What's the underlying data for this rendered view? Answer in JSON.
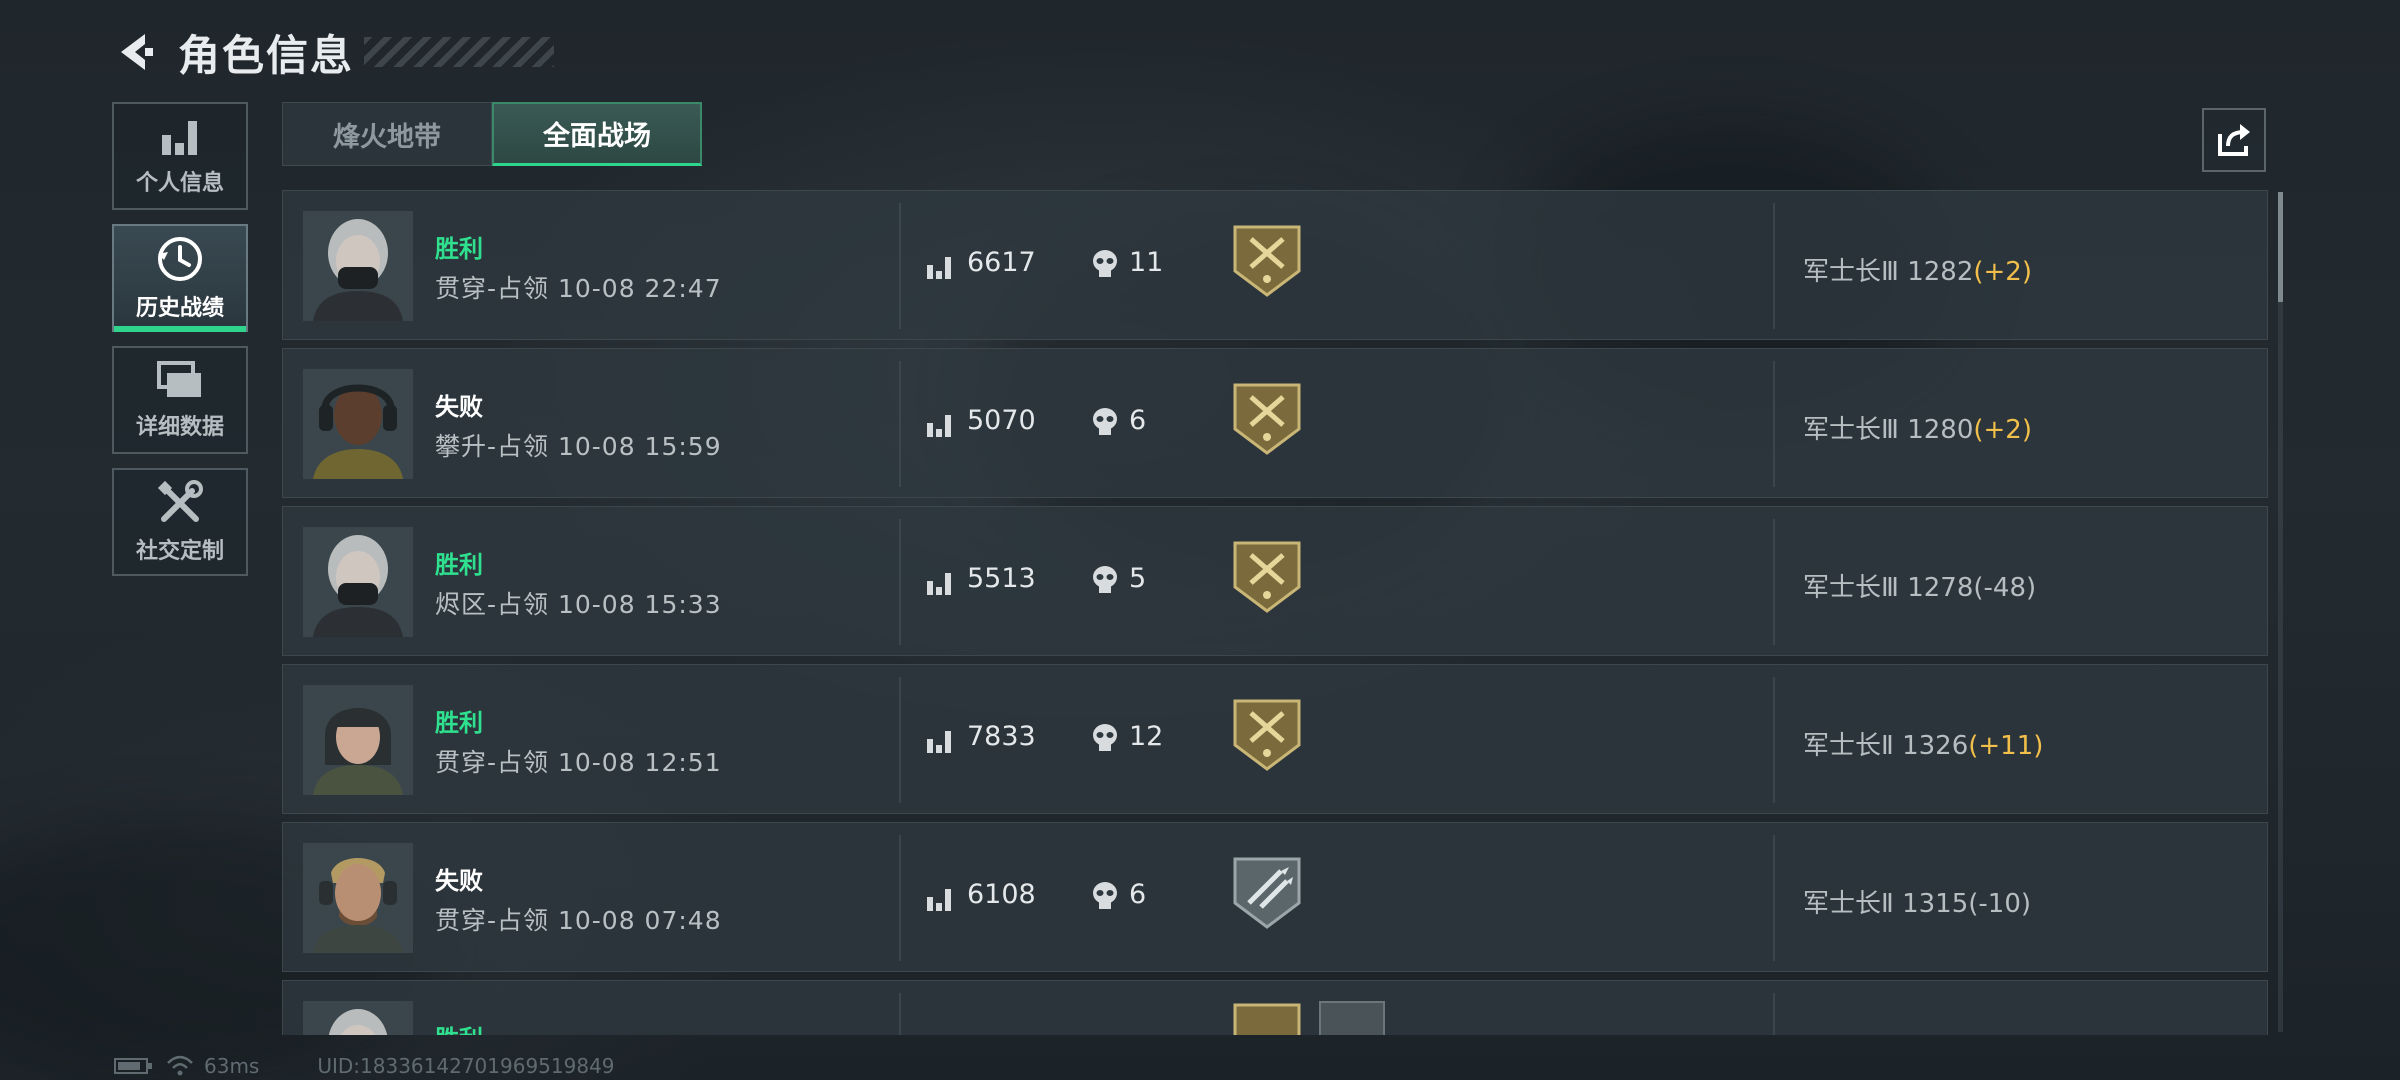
{
  "header": {
    "title": "角色信息"
  },
  "sidebar": {
    "items": [
      {
        "label": "个人信息",
        "icon": "bar-chart-icon"
      },
      {
        "label": "历史战绩",
        "icon": "history-clock-icon"
      },
      {
        "label": "详细数据",
        "icon": "folders-icon"
      },
      {
        "label": "社交定制",
        "icon": "tools-icon"
      }
    ],
    "active_index": 1
  },
  "tabs": [
    {
      "label": "烽火地带"
    },
    {
      "label": "全面战场"
    }
  ],
  "active_tab": 1,
  "matches": [
    {
      "result": "胜利",
      "outcome": "win",
      "mode_time": "贯穿-占领 10-08 22:47",
      "score": "6617",
      "kills": "11",
      "medal": "gold-axes-medal-icon",
      "rank_name": "军士长Ⅲ",
      "rank_points": "1282",
      "rank_delta": "(+2)",
      "delta_type": "pos"
    },
    {
      "result": "失败",
      "outcome": "lose",
      "mode_time": "攀升-占领 10-08 15:59",
      "score": "5070",
      "kills": "6",
      "medal": "gold-axes-medal-icon",
      "rank_name": "军士长Ⅲ",
      "rank_points": "1280",
      "rank_delta": "(+2)",
      "delta_type": "pos"
    },
    {
      "result": "胜利",
      "outcome": "win",
      "mode_time": "烬区-占领 10-08 15:33",
      "score": "5513",
      "kills": "5",
      "medal": "gold-axes-medal-icon",
      "rank_name": "军士长Ⅲ",
      "rank_points": "1278",
      "rank_delta": "(-48)",
      "delta_type": "neg"
    },
    {
      "result": "胜利",
      "outcome": "win",
      "mode_time": "贯穿-占领 10-08 12:51",
      "score": "7833",
      "kills": "12",
      "medal": "gold-axes-medal-icon",
      "rank_name": "军士长Ⅱ",
      "rank_points": "1326",
      "rank_delta": "(+11)",
      "delta_type": "pos"
    },
    {
      "result": "失败",
      "outcome": "lose",
      "mode_time": "贯穿-占领 10-08 07:48",
      "score": "6108",
      "kills": "6",
      "medal": "silver-rockets-medal-icon",
      "rank_name": "军士长Ⅱ",
      "rank_points": "1315",
      "rank_delta": "(-10)",
      "delta_type": "neg"
    },
    {
      "result": "胜利",
      "outcome": "win",
      "mode_time": "",
      "score": "",
      "kills": "",
      "medal": "gold-axes-medal-icon",
      "rank_name": "",
      "rank_points": "",
      "rank_delta": "",
      "delta_type": "pos"
    }
  ],
  "footer": {
    "ping": "63ms",
    "uid": "UID:18336142701969519849"
  },
  "colors": {
    "win": "#2fe08f",
    "accent": "#2fd58d",
    "delta_pos": "#f2c04a"
  }
}
